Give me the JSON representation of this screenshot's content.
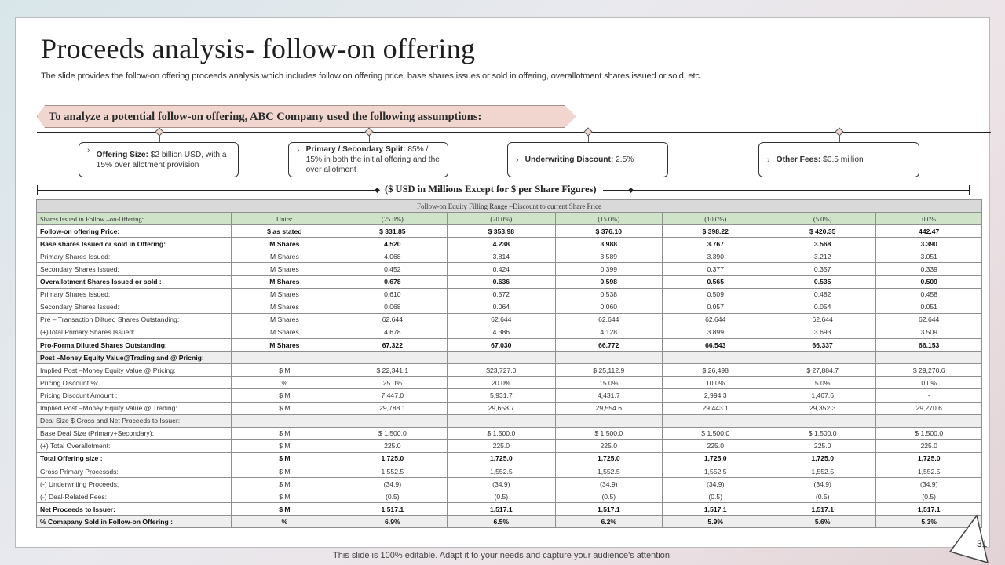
{
  "title": "Proceeds analysis- follow-on offering",
  "subtitle": "The slide provides the follow-on offering proceeds analysis which includes follow on offering price, base shares issues or sold in offering, overallotment shares issued or sold, etc.",
  "banner": "To analyze a potential follow-on  offering, ABC Company  used the following  assumptions:",
  "assumptions": [
    {
      "label": "Offering Size:",
      "text": " $2 billion USD, with a 15% over allotment provision"
    },
    {
      "label": "Primary / Secondary Split:",
      "text": " 85% / 15% in  both the initial offering and the over allotment"
    },
    {
      "label": "Underwriting Discount:",
      "text": " 2.5%"
    },
    {
      "label": "Other Fees:",
      "text": " $0.5 million"
    }
  ],
  "usd_label": "($ USD  in Millions Except  for  $ per Share Figures)",
  "table": {
    "header1": "Follow-on Equity Filling Range –Discount to current Share Price",
    "header2": [
      "Shares Issued in Follow –on-Offering:",
      "Units:",
      "(25.0%)",
      "(20.0%)",
      "(15.0%)",
      "(10.0%)",
      "(5.0%)",
      "0.0%"
    ],
    "rows": [
      {
        "style": "bold",
        "cells": [
          "Follow-on offering Price:",
          "$ as stated",
          "$ 331.85",
          "$ 353.98",
          "$ 376.10",
          "$ 398.22",
          "$ 420.35",
          "442.47"
        ]
      },
      {
        "style": "bold",
        "cells": [
          "Base shares Issued or sold in Offering:",
          "M Shares",
          "4.520",
          "4.238",
          "3.988",
          "3.767",
          "3.568",
          "3.390"
        ]
      },
      {
        "style": "",
        "cells": [
          "Primary Shares Issued:",
          "M Shares",
          "4.068",
          "3.814",
          "3.589",
          "3.390",
          "3.212",
          "3.051"
        ]
      },
      {
        "style": "",
        "cells": [
          "Secondary Shares Issued:",
          "M Shares",
          "0.452",
          "0.424",
          "0.399",
          "0.377",
          "0.357",
          "0.339"
        ]
      },
      {
        "style": "bold",
        "cells": [
          "Overallotment  Shares Issued or sold :",
          "M Shares",
          "0.678",
          "0.636",
          "0.598",
          "0.565",
          "0.535",
          "0.509"
        ]
      },
      {
        "style": "",
        "cells": [
          "Primary Shares Issued:",
          "M Shares",
          "0.610",
          "0.572",
          "0.538",
          "0.509",
          "0.482",
          "0.458"
        ]
      },
      {
        "style": "",
        "cells": [
          "Secondary Shares Issued:",
          "M Shares",
          "0.068",
          "0.064",
          "0.060",
          "0.057",
          "0.054",
          "0.051"
        ]
      },
      {
        "style": "",
        "cells": [
          "Pre – Transaction Diltued Shares Outstanding:",
          "M Shares",
          "62.644",
          "62.644",
          "62.644",
          "62.644",
          "62.644",
          "62.644"
        ]
      },
      {
        "style": "",
        "cells": [
          "(+)Total Primary Shares Issued:",
          "M Shares",
          "4.678",
          "4.386",
          "4.128",
          "3.899",
          "3.693",
          "3.509"
        ]
      },
      {
        "style": "bold",
        "cells": [
          "Pro-Forma Diluted Shares Outstanding:",
          "M Shares",
          "67.322",
          "67.030",
          "66.772",
          "66.543",
          "66.337",
          "66.153"
        ]
      },
      {
        "style": "sect shade",
        "cells": [
          "Post –Money Equity Value@Trading and @ Pricnig:",
          "",
          "",
          "",
          "",
          "",
          "",
          ""
        ]
      },
      {
        "style": "",
        "cells": [
          "Implied Post –Money Equity Value @ Pricing:",
          "$ M",
          "$ 22,341.1",
          "$23,727.0",
          "$ 25,112.9",
          "$ 26,498",
          "$ 27,884.7",
          "$ 29,270.6"
        ]
      },
      {
        "style": "",
        "cells": [
          "Pricing Discount %:",
          "%",
          "25.0%",
          "20.0%",
          "15.0%",
          "10.0%",
          "5.0%",
          "0.0%"
        ]
      },
      {
        "style": "",
        "cells": [
          "Pricing Discount Amount :",
          "$ M",
          "7,447.0",
          "5,931.7",
          "4,431.7",
          "2,994.3",
          "1,467.6",
          "-"
        ]
      },
      {
        "style": "",
        "cells": [
          "Implied Post –Money Equity Value @ Trading:",
          "$ M",
          "29,788.1",
          "29,658.7",
          "29,554.6",
          "29,443.1",
          "29,352.3",
          "29,270.6"
        ]
      },
      {
        "style": "shade",
        "cells": [
          "Deal Size $ Gross and Net Proceeds to Issuer:",
          "",
          "",
          "",
          "",
          "",
          "",
          ""
        ]
      },
      {
        "style": "",
        "cells": [
          "Base Deal Size  (Primary+Secondary):",
          "$ M",
          "$ 1,500.0",
          "$ 1,500.0",
          "$ 1,500.0",
          "$ 1,500.0",
          "$ 1,500.0",
          "$ 1,500.0"
        ]
      },
      {
        "style": "",
        "cells": [
          "(+) Total  Overallotment:",
          "$ M",
          "225.0",
          "225.0",
          "225.0",
          "225.0",
          "225.0",
          "225.0"
        ]
      },
      {
        "style": "bold",
        "cells": [
          "Total Offering size :",
          "$ M",
          "1,725.0",
          "1,725.0",
          "1,725.0",
          "1,725.0",
          "1,725.0",
          "1,725.0"
        ]
      },
      {
        "style": "",
        "cells": [
          "Gross Primary Processds:",
          "$ M",
          "1,552.5",
          "1,552.5",
          "1,552.5",
          "1,552.5",
          "1,552.5",
          "1,552.5"
        ]
      },
      {
        "style": "",
        "cells": [
          "(-) Underwriting Proceeds:",
          "$ M",
          "(34.9)",
          "(34.9)",
          "(34.9)",
          "(34.9)",
          "(34.9)",
          "(34.9)"
        ]
      },
      {
        "style": "",
        "cells": [
          "(-) Deal-Related Fees:",
          "$ M",
          "(0.5)",
          "(0.5)",
          "(0.5)",
          "(0.5)",
          "(0.5)",
          "(0.5)"
        ]
      },
      {
        "style": "bold",
        "cells": [
          "Net Proceeds to Issuer:",
          "$ M",
          "1,517.1",
          "1,517.1",
          "1,517.1",
          "1,517.1",
          "1,517.1",
          "1,517.1"
        ]
      },
      {
        "style": "bold shade",
        "cells": [
          "% Comapany Sold in Follow-on Offering :",
          "%",
          "6.9%",
          "6.5%",
          "6.2%",
          "5.9%",
          "5.6%",
          "5.3%"
        ]
      }
    ]
  },
  "footer": "This slide is 100% editable. Adapt it to your needs and capture your audience's attention.",
  "page_number": "31"
}
